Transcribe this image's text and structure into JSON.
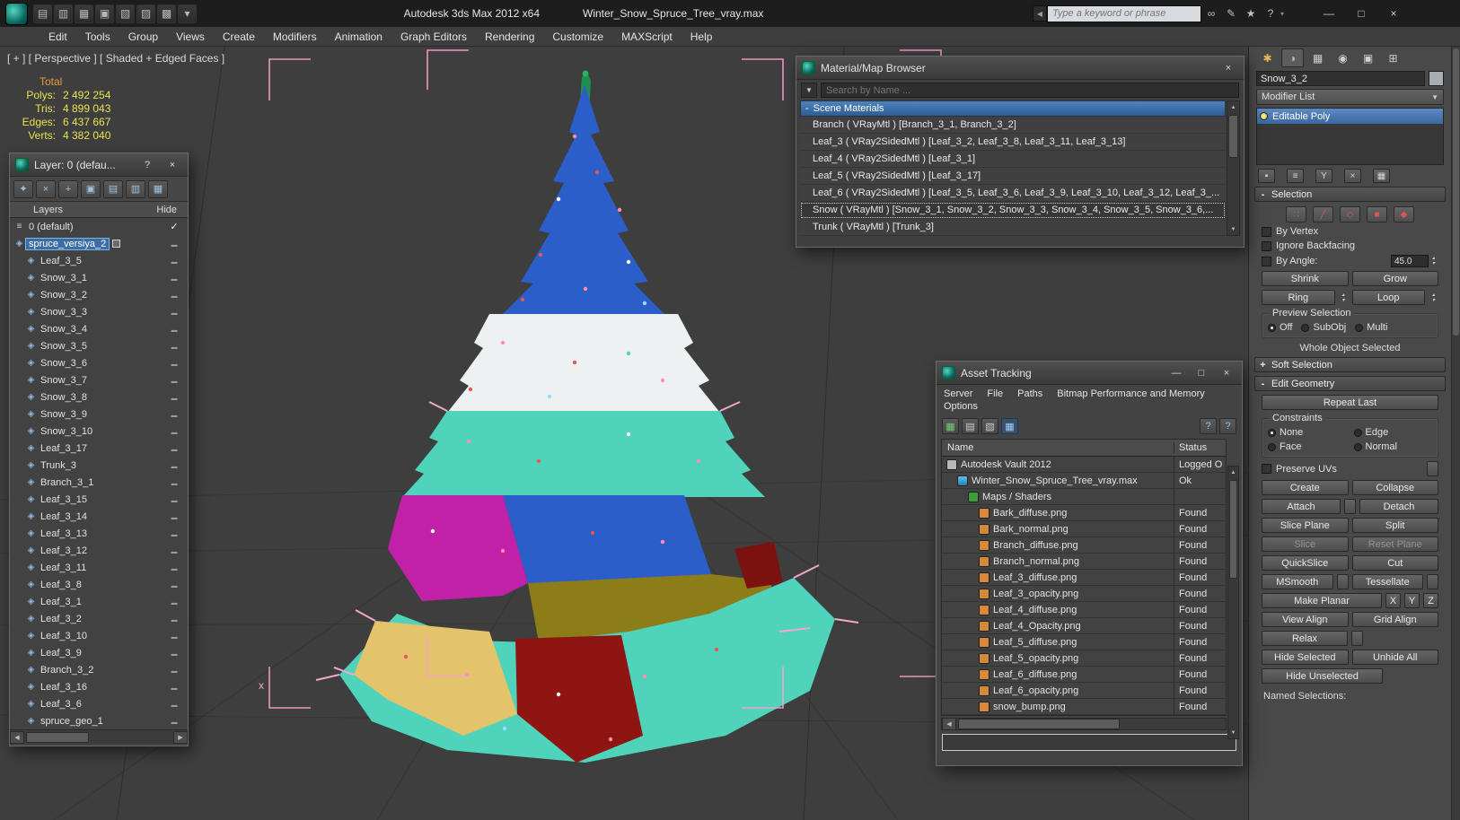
{
  "colors": {
    "selection_blue": "#3a6ea5",
    "stats_yellow": "#e8e350",
    "stats_orange": "#e89a3c",
    "bracket_pink": "#ff9fce",
    "viewport_bg": "#3e3e3e",
    "scene_header_blue": "#2c5c94"
  },
  "icons": {
    "back": "◀",
    "minimize": "—",
    "maximize": "□",
    "close": "×",
    "help": "?",
    "dropdown": "▼",
    "minus": "-",
    "plus": "+",
    "up": "▲",
    "down": "▼",
    "left": "◀",
    "right": "▶",
    "spin_up": "▴",
    "spin_down": "▾"
  },
  "titlebar": {
    "app_title": "Autodesk 3ds Max 2012 x64",
    "file_title": "Winter_Snow_Spruce_Tree_vray.max",
    "search_placeholder": "Type a keyword or phrase",
    "qat": [
      "▤",
      "▥",
      "▦",
      "▣",
      "▧",
      "▨",
      "▩",
      "▾"
    ],
    "infocenter": [
      "∞",
      "✎",
      "★",
      "?"
    ]
  },
  "menubar": [
    "Edit",
    "Tools",
    "Group",
    "Views",
    "Create",
    "Modifiers",
    "Animation",
    "Graph Editors",
    "Rendering",
    "Customize",
    "MAXScript",
    "Help"
  ],
  "viewport": {
    "label": "[ + ] [ Perspective ] [ Shaded + Edged Faces ]",
    "stats_title": "Total",
    "stats": [
      {
        "label": "Polys:",
        "value": "2 492 254"
      },
      {
        "label": "Tris:",
        "value": "4 899 043"
      },
      {
        "label": "Edges:",
        "value": "6 437 667"
      },
      {
        "label": "Verts:",
        "value": "4 382 040"
      }
    ],
    "axis_label": "x"
  },
  "layer_dialog": {
    "title": "Layer: 0 (defau...",
    "tools": [
      "✦",
      "×",
      "+",
      "▣",
      "▤",
      "▥",
      "▦"
    ],
    "col_layers": "Layers",
    "col_hide": "Hide",
    "items": [
      {
        "label": "0 (default)",
        "level": 0,
        "icon": "list",
        "mark": "check"
      },
      {
        "label": "spruce_versiya_2",
        "level": 0,
        "icon": "layer",
        "selected": true,
        "box": true,
        "mark": "dash"
      },
      {
        "label": "Leaf_3_5",
        "level": 1,
        "icon": "layer",
        "mark": "dash"
      },
      {
        "label": "Snow_3_1",
        "level": 1,
        "icon": "layer",
        "mark": "dash"
      },
      {
        "label": "Snow_3_2",
        "level": 1,
        "icon": "layer",
        "mark": "dash"
      },
      {
        "label": "Snow_3_3",
        "level": 1,
        "icon": "layer",
        "mark": "dash"
      },
      {
        "label": "Snow_3_4",
        "level": 1,
        "icon": "layer",
        "mark": "dash"
      },
      {
        "label": "Snow_3_5",
        "level": 1,
        "icon": "layer",
        "mark": "dash"
      },
      {
        "label": "Snow_3_6",
        "level": 1,
        "icon": "layer",
        "mark": "dash"
      },
      {
        "label": "Snow_3_7",
        "level": 1,
        "icon": "layer",
        "mark": "dash"
      },
      {
        "label": "Snow_3_8",
        "level": 1,
        "icon": "layer",
        "mark": "dash"
      },
      {
        "label": "Snow_3_9",
        "level": 1,
        "icon": "layer",
        "mark": "dash"
      },
      {
        "label": "Snow_3_10",
        "level": 1,
        "icon": "layer",
        "mark": "dash"
      },
      {
        "label": "Leaf_3_17",
        "level": 1,
        "icon": "layer",
        "mark": "dash"
      },
      {
        "label": "Trunk_3",
        "level": 1,
        "icon": "layer",
        "mark": "dash"
      },
      {
        "label": "Branch_3_1",
        "level": 1,
        "icon": "layer",
        "mark": "dash"
      },
      {
        "label": "Leaf_3_15",
        "level": 1,
        "icon": "layer",
        "mark": "dash"
      },
      {
        "label": "Leaf_3_14",
        "level": 1,
        "icon": "layer",
        "mark": "dash"
      },
      {
        "label": "Leaf_3_13",
        "level": 1,
        "icon": "layer",
        "mark": "dash"
      },
      {
        "label": "Leaf_3_12",
        "level": 1,
        "icon": "layer",
        "mark": "dash"
      },
      {
        "label": "Leaf_3_11",
        "level": 1,
        "icon": "layer",
        "mark": "dash"
      },
      {
        "label": "Leaf_3_8",
        "level": 1,
        "icon": "layer",
        "mark": "dash"
      },
      {
        "label": "Leaf_3_1",
        "level": 1,
        "icon": "layer",
        "mark": "dash"
      },
      {
        "label": "Leaf_3_2",
        "level": 1,
        "icon": "layer",
        "mark": "dash"
      },
      {
        "label": "Leaf_3_10",
        "level": 1,
        "icon": "layer",
        "mark": "dash"
      },
      {
        "label": "Leaf_3_9",
        "level": 1,
        "icon": "layer",
        "mark": "dash"
      },
      {
        "label": "Branch_3_2",
        "level": 1,
        "icon": "layer",
        "mark": "dash"
      },
      {
        "label": "Leaf_3_16",
        "level": 1,
        "icon": "layer",
        "mark": "dash"
      },
      {
        "label": "Leaf_3_6",
        "level": 1,
        "icon": "layer",
        "mark": "dash"
      },
      {
        "label": "spruce_geo_1",
        "level": 1,
        "icon": "layer",
        "mark": "dash"
      }
    ]
  },
  "material_browser": {
    "title": "Material/Map Browser",
    "search_placeholder": "Search by Name ...",
    "group": "Scene Materials",
    "rows": [
      {
        "name": "Branch ( VRayMtl ) [Branch_3_1, Branch_3_2]"
      },
      {
        "name": "Leaf_3 ( VRay2SidedMtl ) [Leaf_3_2, Leaf_3_8, Leaf_3_11, Leaf_3_13]"
      },
      {
        "name": "Leaf_4 ( VRay2SidedMtl ) [Leaf_3_1]"
      },
      {
        "name": "Leaf_5 ( VRay2SidedMtl ) [Leaf_3_17]"
      },
      {
        "name": "Leaf_6 ( VRay2SidedMtl ) [Leaf_3_5, Leaf_3_6, Leaf_3_9, Leaf_3_10, Leaf_3_12, Leaf_3_..."
      },
      {
        "name": "Snow ( VRayMtl ) [Snow_3_1, Snow_3_2, Snow_3_3, Snow_3_4, Snow_3_5, Snow_3_6,...",
        "selected": true
      },
      {
        "name": "Trunk ( VRayMtl ) [Trunk_3]"
      }
    ]
  },
  "asset_tracking": {
    "title": "Asset Tracking",
    "menu": [
      "Server",
      "File",
      "Paths",
      "Bitmap Performance and Memory",
      "Options"
    ],
    "tools_left": [
      "▦",
      "▤",
      "▧",
      "▦"
    ],
    "tools_right": [
      "?",
      "?"
    ],
    "col_name": "Name",
    "col_status": "Status",
    "rows": [
      {
        "name": "Autodesk Vault 2012",
        "status": "Logged O",
        "icon": "vault",
        "level": 0
      },
      {
        "name": "Winter_Snow_Spruce_Tree_vray.max",
        "status": "Ok",
        "icon": "max",
        "level": 1
      },
      {
        "name": "Maps / Shaders",
        "status": "",
        "icon": "maps",
        "level": 2
      },
      {
        "name": "Bark_diffuse.png",
        "status": "Found",
        "icon": "png",
        "level": 3
      },
      {
        "name": "Bark_normal.png",
        "status": "Found",
        "icon": "png",
        "level": 3
      },
      {
        "name": "Branch_diffuse.png",
        "status": "Found",
        "icon": "png",
        "level": 3
      },
      {
        "name": "Branch_normal.png",
        "status": "Found",
        "icon": "png",
        "level": 3
      },
      {
        "name": "Leaf_3_diffuse.png",
        "status": "Found",
        "icon": "png",
        "level": 3
      },
      {
        "name": "Leaf_3_opacity.png",
        "status": "Found",
        "icon": "png",
        "level": 3
      },
      {
        "name": "Leaf_4_diffuse.png",
        "status": "Found",
        "icon": "png",
        "level": 3
      },
      {
        "name": "Leaf_4_Opacity.png",
        "status": "Found",
        "icon": "png",
        "level": 3
      },
      {
        "name": "Leaf_5_diffuse.png",
        "status": "Found",
        "icon": "png",
        "level": 3
      },
      {
        "name": "Leaf_5_opacity.png",
        "status": "Found",
        "icon": "png",
        "level": 3
      },
      {
        "name": "Leaf_6_diffuse.png",
        "status": "Found",
        "icon": "png",
        "level": 3
      },
      {
        "name": "Leaf_6_opacity.png",
        "status": "Found",
        "icon": "png",
        "level": 3
      },
      {
        "name": "snow_bump.png",
        "status": "Found",
        "icon": "png",
        "level": 3
      }
    ]
  },
  "command_panel": {
    "tabs": [
      "✱",
      "◑",
      "▦",
      "◉",
      "▣",
      "⊞"
    ],
    "object_name": "Snow_3_2",
    "modifier_list": "Modifier List",
    "stack_item": "Editable Poly",
    "stack_tools": [
      "▪",
      "≡",
      "Y",
      "×",
      "▦"
    ],
    "selection": {
      "title": "Selection",
      "subobj_icons": [
        "∷",
        "╱",
        "◇",
        "■",
        "◆"
      ],
      "by_vertex": "By Vertex",
      "ignore_backfacing": "Ignore Backfacing",
      "by_angle": "By Angle:",
      "by_angle_value": "45.0",
      "shrink": "Shrink",
      "grow": "Grow",
      "ring": "Ring",
      "loop": "Loop",
      "preview_label": "Preview Selection",
      "preview_off": "Off",
      "preview_subobj": "SubObj",
      "preview_multi": "Multi",
      "status": "Whole Object Selected"
    },
    "soft_selection_title": "Soft Selection",
    "edit_geometry": {
      "title": "Edit Geometry",
      "repeat_last": "Repeat Last",
      "constraints": "Constraints",
      "none": "None",
      "edge": "Edge",
      "face": "Face",
      "normal": "Normal",
      "preserve_uvs": "Preserve UVs",
      "create": "Create",
      "collapse": "Collapse",
      "attach": "Attach",
      "detach": "Detach",
      "slice_plane": "Slice Plane",
      "split": "Split",
      "slice": "Slice",
      "reset_plane": "Reset Plane",
      "quickslice": "QuickSlice",
      "cut": "Cut",
      "msmooth": "MSmooth",
      "tessellate": "Tessellate",
      "make_planar": "Make Planar",
      "x": "X",
      "y": "Y",
      "z": "Z",
      "view_align": "View Align",
      "grid_align": "Grid Align",
      "relax": "Relax",
      "hide_selected": "Hide Selected",
      "unhide_all": "Unhide All",
      "hide_unselected": "Hide Unselected",
      "named_selections": "Named Selections:"
    }
  }
}
